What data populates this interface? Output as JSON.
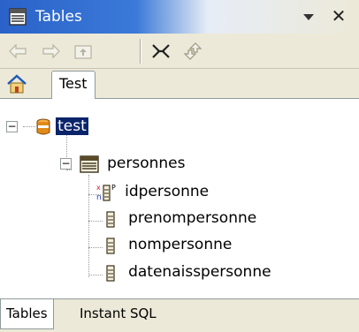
{
  "window": {
    "title": "Tables",
    "title_icon": "table-icon",
    "menu_icon": "view-menu-triangle-icon",
    "close_glyph": "✕"
  },
  "toolbar": {
    "buttons": [
      {
        "name": "back-button",
        "icon": "back-arrow-icon"
      },
      {
        "name": "forward-button",
        "icon": "forward-arrow-icon"
      },
      {
        "name": "up-button",
        "icon": "up-folder-icon"
      },
      {
        "name": "collapse-all-button",
        "icon": "collapse-all-icon"
      },
      {
        "name": "link-editor-button",
        "icon": "link-arrows-icon"
      }
    ]
  },
  "tabs": {
    "home_icon": "home-icon",
    "active_tab": "Test"
  },
  "tree": {
    "root": {
      "label": "test",
      "icon": "database-icon",
      "expanded": true,
      "selected": true
    },
    "table": {
      "label": "personnes",
      "icon": "table-icon",
      "expanded": true
    },
    "columns": [
      {
        "label": "idpersonne",
        "icon": "primary-key-column-icon"
      },
      {
        "label": "prenompersonne",
        "icon": "column-icon"
      },
      {
        "label": "nompersonne",
        "icon": "column-icon"
      },
      {
        "label": "datenaisspersonne",
        "icon": "column-icon"
      }
    ]
  },
  "bottom_tabs": [
    {
      "label": "Tables",
      "active": true
    },
    {
      "label": "Instant SQL",
      "active": false
    }
  ],
  "colors": {
    "title_blue": "#2a62c9",
    "selection": "#0a246a",
    "chrome": "#ece9d8"
  }
}
